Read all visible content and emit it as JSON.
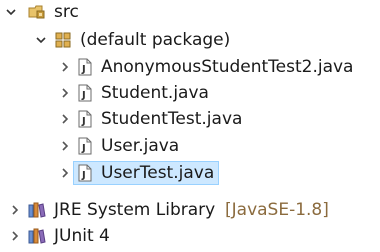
{
  "tree": {
    "src": {
      "label": "src"
    },
    "default_package": {
      "label": "(default package)"
    },
    "files": [
      {
        "label": "AnonymousStudentTest2.java"
      },
      {
        "label": "Student.java"
      },
      {
        "label": "StudentTest.java"
      },
      {
        "label": "User.java"
      },
      {
        "label": "UserTest.java",
        "selected": true
      }
    ],
    "jre": {
      "label": "JRE System Library",
      "decoration": "[JavaSE-1.8]"
    },
    "junit": {
      "label": "JUnit 4"
    }
  },
  "colors": {
    "selection": "#cde8ff",
    "selection_border": "#99d1ff",
    "decoration": "#8b6b3e",
    "package_icon": "#c28d2b",
    "java_file_icon": "#6b6b6b"
  }
}
